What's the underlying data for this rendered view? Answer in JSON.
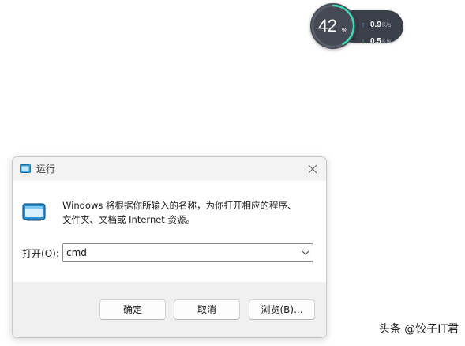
{
  "widget": {
    "cpu_percent": 42,
    "cpu_value": "42",
    "cpu_unit": "%",
    "upload_value": "0.9",
    "upload_unit": "K/s",
    "download_value": "0.5",
    "download_unit": "K/s",
    "colors": {
      "ring": "#3dd9b5",
      "upload": "#4fb3ff",
      "download": "#5ad06a"
    }
  },
  "dialog": {
    "title": "运行",
    "description_line1": "Windows 将根据你所输入的名称，为你打开相应的程序、",
    "description_line2": "文件夹、文档或 Internet 资源。",
    "open_label_prefix": "打开(",
    "open_label_accel": "O",
    "open_label_suffix": "):",
    "input_value": "cmd",
    "buttons": {
      "ok": "确定",
      "cancel": "取消",
      "browse_prefix": "浏览(",
      "browse_accel": "B",
      "browse_suffix": ")..."
    }
  },
  "watermark": "头条 @饺子IT君"
}
